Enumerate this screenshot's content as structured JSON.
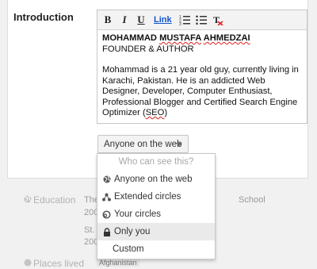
{
  "section": {
    "title": "Introduction"
  },
  "toolbar": {
    "bold": "B",
    "italic": "I",
    "underline": "U",
    "link": "Link"
  },
  "editor": {
    "name_first": "MOHAMMAD",
    "name_middle": "MUSTAFA",
    "name_last": "AHMEDZAI",
    "subtitle": "FOUNDER & AUTHOR",
    "bio_part1": "Mohammad is a 21 year old guy, currently living in Karachi, Pakistan. He is an addicted Web Designer, Developer, Computer Enthusiast, Professional Blogger and Certified Search Engine Optimizer (",
    "bio_seo": "SEO",
    "bio_part3": ")"
  },
  "visibility": {
    "selected_label": "Anyone on the web",
    "menu_header": "Who can see this?",
    "options": [
      {
        "label": "Anyone on the web",
        "icon": "globe-icon"
      },
      {
        "label": "Extended circles",
        "icon": "extended-circles-icon"
      },
      {
        "label": "Your circles",
        "icon": "circles-icon"
      },
      {
        "label": "Only you",
        "icon": "lock-icon"
      },
      {
        "label": "Custom",
        "icon": ""
      }
    ],
    "highlighted_option": "Only you"
  },
  "background": {
    "education_label": "Education",
    "edu_row1_left": "The",
    "edu_row1_right": "School",
    "edu_row2": "200",
    "edu_row3": "St. I",
    "edu_row4": "200",
    "places_label": "Places lived",
    "places_value": "Afghanistan"
  }
}
